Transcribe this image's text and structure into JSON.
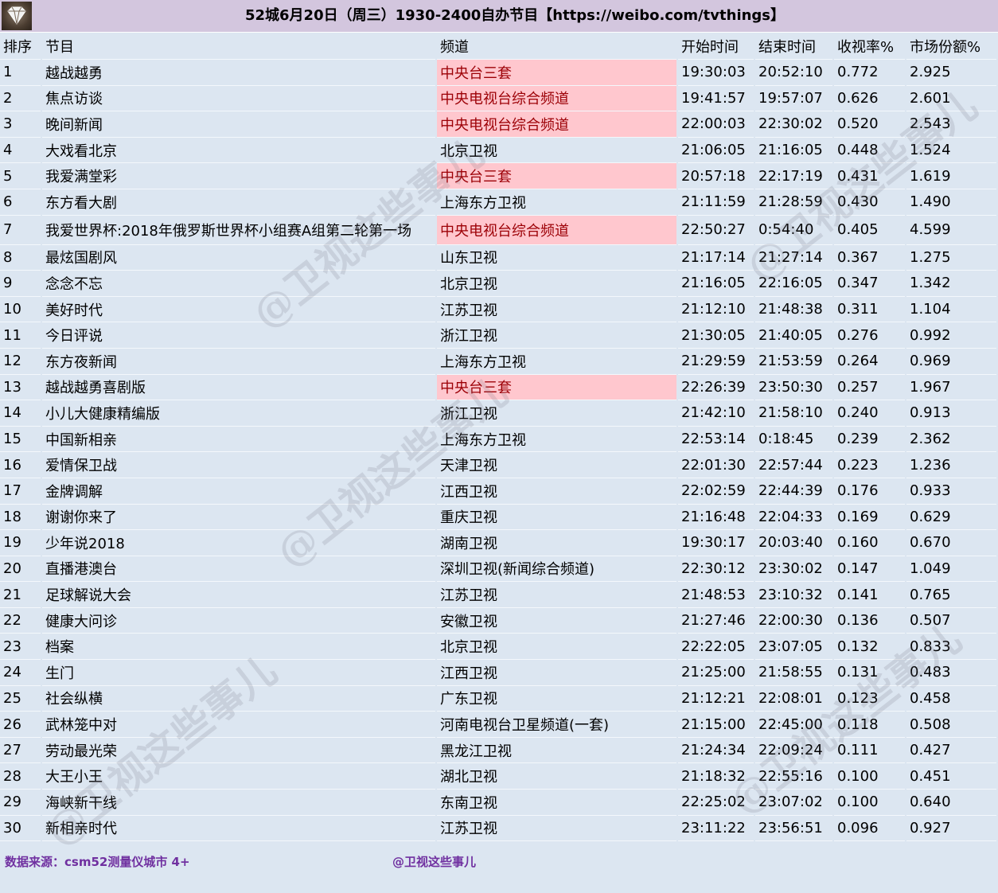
{
  "title": "52城6月20日（周三）1930-2400自办节目【https://weibo.com/tvthings】",
  "logo_icon": "diamond-logo-icon",
  "columns": [
    "排序",
    "节目",
    "频道",
    "开始时间",
    "结束时间",
    "收视率%",
    "市场份额%"
  ],
  "highlight_color": "#ffc7ce",
  "highlight_text_color": "#9c0006",
  "rows": [
    {
      "rank": "1",
      "program": "越战越勇",
      "channel": "中央台三套",
      "start": "19:30:03",
      "end": "20:52:10",
      "rating": "0.772",
      "share": "2.925",
      "highlight": true
    },
    {
      "rank": "2",
      "program": "焦点访谈",
      "channel": "中央电视台综合频道",
      "start": "19:41:57",
      "end": "19:57:07",
      "rating": "0.626",
      "share": "2.601",
      "highlight": true
    },
    {
      "rank": "3",
      "program": "晚间新闻",
      "channel": "中央电视台综合频道",
      "start": "22:00:03",
      "end": "22:30:02",
      "rating": "0.520",
      "share": "2.543",
      "highlight": true
    },
    {
      "rank": "4",
      "program": "大戏看北京",
      "channel": "北京卫视",
      "start": "21:06:05",
      "end": "21:16:05",
      "rating": "0.448",
      "share": "1.524",
      "highlight": false
    },
    {
      "rank": "5",
      "program": "我爱满堂彩",
      "channel": "中央台三套",
      "start": "20:57:18",
      "end": "22:17:19",
      "rating": "0.431",
      "share": "1.619",
      "highlight": true
    },
    {
      "rank": "6",
      "program": "东方看大剧",
      "channel": "上海东方卫视",
      "start": "21:11:59",
      "end": "21:28:59",
      "rating": "0.430",
      "share": "1.490",
      "highlight": false
    },
    {
      "rank": "7",
      "program": "我爱世界杯:2018年俄罗斯世界杯小组赛A组第二轮第一场",
      "channel": "中央电视台综合频道",
      "start": "22:50:27",
      "end": "0:54:40",
      "rating": "0.405",
      "share": "4.599",
      "highlight": true
    },
    {
      "rank": "8",
      "program": "最炫国剧风",
      "channel": "山东卫视",
      "start": "21:17:14",
      "end": "21:27:14",
      "rating": "0.367",
      "share": "1.275",
      "highlight": false
    },
    {
      "rank": "9",
      "program": "念念不忘",
      "channel": "北京卫视",
      "start": "21:16:05",
      "end": "22:16:05",
      "rating": "0.347",
      "share": "1.342",
      "highlight": false
    },
    {
      "rank": "10",
      "program": "美好时代",
      "channel": "江苏卫视",
      "start": "21:12:10",
      "end": "21:48:38",
      "rating": "0.311",
      "share": "1.104",
      "highlight": false
    },
    {
      "rank": "11",
      "program": "今日评说",
      "channel": "浙江卫视",
      "start": "21:30:05",
      "end": "21:40:05",
      "rating": "0.276",
      "share": "0.992",
      "highlight": false
    },
    {
      "rank": "12",
      "program": "东方夜新闻",
      "channel": "上海东方卫视",
      "start": "21:29:59",
      "end": "21:53:59",
      "rating": "0.264",
      "share": "0.969",
      "highlight": false
    },
    {
      "rank": "13",
      "program": "越战越勇喜剧版",
      "channel": "中央台三套",
      "start": "22:26:39",
      "end": "23:50:30",
      "rating": "0.257",
      "share": "1.967",
      "highlight": true
    },
    {
      "rank": "14",
      "program": "小儿大健康精编版",
      "channel": "浙江卫视",
      "start": "21:42:10",
      "end": "21:58:10",
      "rating": "0.240",
      "share": "0.913",
      "highlight": false
    },
    {
      "rank": "15",
      "program": "中国新相亲",
      "channel": "上海东方卫视",
      "start": "22:53:14",
      "end": "0:18:45",
      "rating": "0.239",
      "share": "2.362",
      "highlight": false
    },
    {
      "rank": "16",
      "program": "爱情保卫战",
      "channel": "天津卫视",
      "start": "22:01:30",
      "end": "22:57:44",
      "rating": "0.223",
      "share": "1.236",
      "highlight": false
    },
    {
      "rank": "17",
      "program": "金牌调解",
      "channel": "江西卫视",
      "start": "22:02:59",
      "end": "22:44:39",
      "rating": "0.176",
      "share": "0.933",
      "highlight": false
    },
    {
      "rank": "18",
      "program": "谢谢你来了",
      "channel": "重庆卫视",
      "start": "21:16:48",
      "end": "22:04:33",
      "rating": "0.169",
      "share": "0.629",
      "highlight": false
    },
    {
      "rank": "19",
      "program": "少年说2018",
      "channel": "湖南卫视",
      "start": "19:30:17",
      "end": "20:03:40",
      "rating": "0.160",
      "share": "0.670",
      "highlight": false
    },
    {
      "rank": "20",
      "program": "直播港澳台",
      "channel": "深圳卫视(新闻综合频道)",
      "start": "22:30:12",
      "end": "23:30:02",
      "rating": "0.147",
      "share": "1.049",
      "highlight": false
    },
    {
      "rank": "21",
      "program": "足球解说大会",
      "channel": "江苏卫视",
      "start": "21:48:53",
      "end": "23:10:32",
      "rating": "0.141",
      "share": "0.765",
      "highlight": false
    },
    {
      "rank": "22",
      "program": "健康大问诊",
      "channel": "安徽卫视",
      "start": "21:27:46",
      "end": "22:00:30",
      "rating": "0.136",
      "share": "0.507",
      "highlight": false
    },
    {
      "rank": "23",
      "program": "档案",
      "channel": "北京卫视",
      "start": "22:22:05",
      "end": "23:07:05",
      "rating": "0.132",
      "share": "0.833",
      "highlight": false
    },
    {
      "rank": "24",
      "program": "生门",
      "channel": "江西卫视",
      "start": "21:25:00",
      "end": "21:58:55",
      "rating": "0.131",
      "share": "0.483",
      "highlight": false
    },
    {
      "rank": "25",
      "program": "社会纵横",
      "channel": "广东卫视",
      "start": "21:12:21",
      "end": "22:08:01",
      "rating": "0.123",
      "share": "0.458",
      "highlight": false
    },
    {
      "rank": "26",
      "program": "武林笼中对",
      "channel": "河南电视台卫星频道(一套)",
      "start": "21:15:00",
      "end": "22:45:00",
      "rating": "0.118",
      "share": "0.508",
      "highlight": false
    },
    {
      "rank": "27",
      "program": "劳动最光荣",
      "channel": "黑龙江卫视",
      "start": "21:24:34",
      "end": "22:09:24",
      "rating": "0.111",
      "share": "0.427",
      "highlight": false
    },
    {
      "rank": "28",
      "program": "大王小王",
      "channel": "湖北卫视",
      "start": "21:18:32",
      "end": "22:55:16",
      "rating": "0.100",
      "share": "0.451",
      "highlight": false
    },
    {
      "rank": "29",
      "program": "海峡新干线",
      "channel": "东南卫视",
      "start": "22:25:02",
      "end": "23:07:02",
      "rating": "0.100",
      "share": "0.640",
      "highlight": false
    },
    {
      "rank": "30",
      "program": "新相亲时代",
      "channel": "江苏卫视",
      "start": "23:11:22",
      "end": "23:56:51",
      "rating": "0.096",
      "share": "0.927",
      "highlight": false
    }
  ],
  "footer": {
    "source": "数据来源：csm52测量仪城市 4+",
    "handle": "@卫视这些事儿"
  },
  "watermark": "@卫视这些事儿"
}
